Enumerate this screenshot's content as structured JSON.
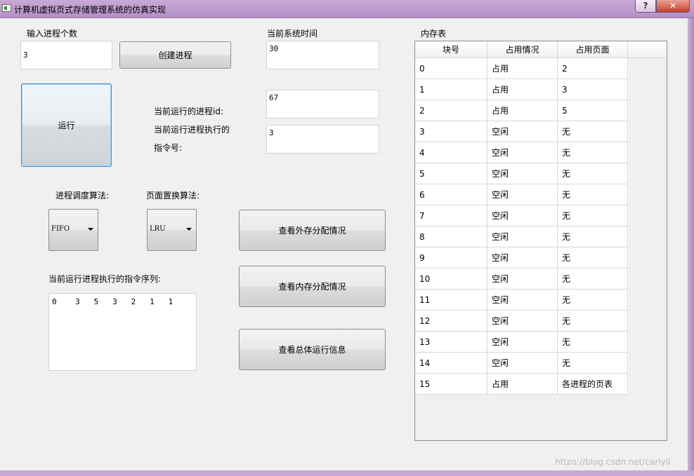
{
  "window": {
    "title": "计算机虚拟页式存储管理系统的仿真实现",
    "help_label": "?",
    "close_label": "✕"
  },
  "process_input": {
    "label": "输入进程个数",
    "value": "3",
    "create_button": "创建进程"
  },
  "run_button": "运行",
  "system_time": {
    "label": "当前系统时间",
    "value": "30"
  },
  "current_process": {
    "id_label": "当前运行的进程id:",
    "id_value": "67",
    "instr_label_line1": "当前运行进程执行的",
    "instr_label_line2": "指令号:",
    "instr_value": "3"
  },
  "algorithms": {
    "scheduling_label": "进程调度算法:",
    "scheduling_value": "FIFO",
    "replacement_label": "页面置换算法:",
    "replacement_value": "LRU"
  },
  "actions": {
    "view_external": "查看外存分配情况",
    "view_memory": "查看内存分配情况",
    "view_overall": "查看总体运行信息"
  },
  "sequence": {
    "label": "当前运行进程执行的指令序列:",
    "value": "0    3   5   3   2   1   1"
  },
  "memory_table": {
    "title": "内存表",
    "headers": [
      "块号",
      "占用情况",
      "占用页面"
    ],
    "rows": [
      [
        "0",
        "占用",
        "2"
      ],
      [
        "1",
        "占用",
        "3"
      ],
      [
        "2",
        "占用",
        "5"
      ],
      [
        "3",
        "空闲",
        "无"
      ],
      [
        "4",
        "空闲",
        "无"
      ],
      [
        "5",
        "空闲",
        "无"
      ],
      [
        "6",
        "空闲",
        "无"
      ],
      [
        "7",
        "空闲",
        "无"
      ],
      [
        "8",
        "空闲",
        "无"
      ],
      [
        "9",
        "空闲",
        "无"
      ],
      [
        "10",
        "空闲",
        "无"
      ],
      [
        "11",
        "空闲",
        "无"
      ],
      [
        "12",
        "空闲",
        "无"
      ],
      [
        "13",
        "空闲",
        "无"
      ],
      [
        "14",
        "空闲",
        "无"
      ],
      [
        "15",
        "占用",
        "各进程的页表"
      ]
    ]
  },
  "watermark": "https://blog.csdn.net/carlyll"
}
